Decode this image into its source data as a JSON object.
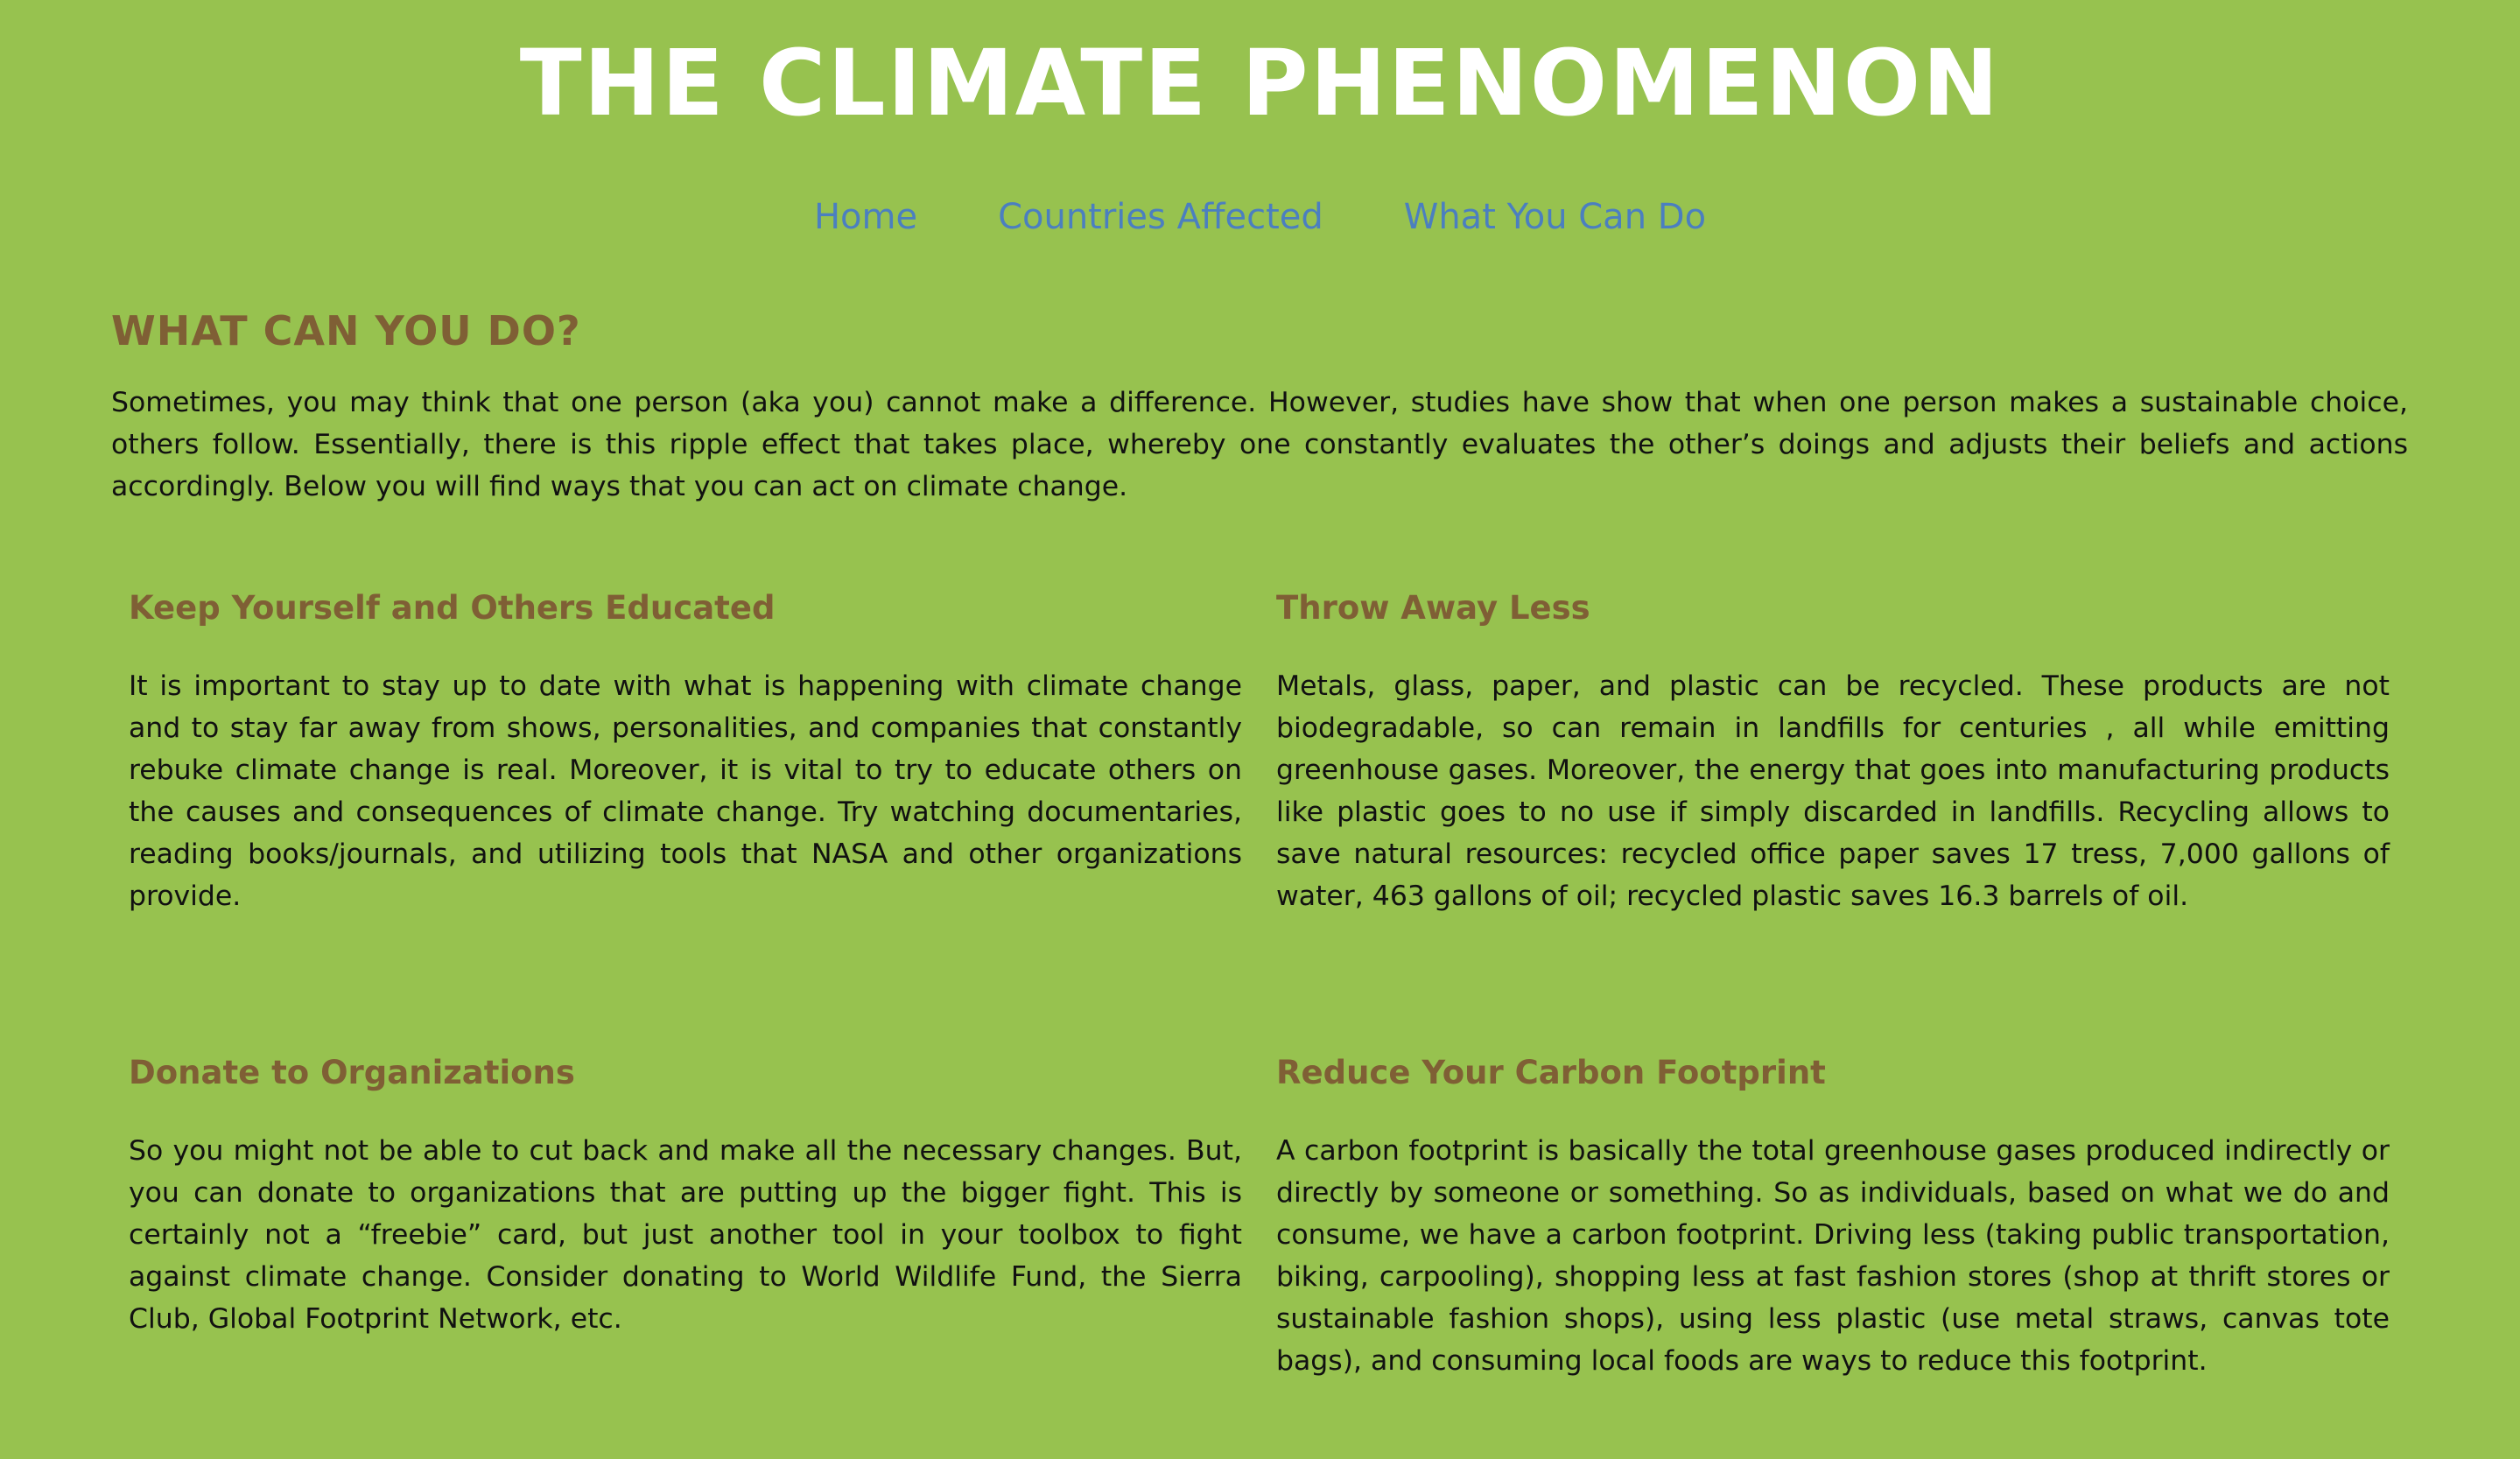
{
  "site": {
    "title": "THE CLIMATE PHENOMENON"
  },
  "nav": {
    "items": [
      {
        "label": "Home"
      },
      {
        "label": "Countries Affected"
      },
      {
        "label": "What You Can Do"
      }
    ]
  },
  "main": {
    "heading": "WHAT CAN YOU DO?",
    "intro": "Sometimes, you may think that one person (aka you) cannot make a difference. However, studies have show that when one person makes a sustainable choice, others follow. Essentially, there is this ripple effect that takes place, whereby one constantly evaluates the other’s doings and adjusts their beliefs and actions accordingly. Below you will find ways that you can act on climate change.",
    "sections": [
      {
        "title": "Keep Yourself and Others Educated",
        "body": "It is important to stay up to date with what is happening with climate change and to stay far away from shows, personalities, and companies that constantly rebuke climate change is real. Moreover, it is vital to try to educate others on the causes and consequences of climate change. Try watching documentaries, reading books/journals, and utilizing tools that NASA and other organizations provide."
      },
      {
        "title": "Throw Away Less",
        "body": "Metals, glass, paper, and plastic can be recycled. These products are not biodegradable, so can remain in landfills for centuries , all while emitting greenhouse gases. Moreover, the energy that goes into manufacturing products like plastic goes to no use if simply discarded in landfills. Recycling allows to save natural resources: recycled office paper saves 17 tress, 7,000 gallons of water, 463 gallons of oil; recycled plastic saves 16.3 barrels of oil."
      },
      {
        "title": "Donate to Organizations",
        "body": "So you might not be able to cut back and make all the necessary changes. But, you can donate to organizations that are putting up the bigger fight. This is certainly not a “freebie” card, but just another tool in your toolbox to fight against climate change. Consider donating to World Wildlife Fund, the Sierra Club, Global Footprint Network, etc."
      },
      {
        "title": "Reduce Your Carbon Footprint",
        "body": "A carbon footprint is basically the total greenhouse gases produced indirectly or directly by someone or something. So as individuals, based on what we do and consume, we have a carbon footprint. Driving less (taking public transportation, biking, carpooling), shopping less at fast fashion stores (shop at thrift stores or sustainable fashion shops), using less plastic (use metal straws, canvas tote bags), and consuming local foods are ways to reduce this footprint."
      }
    ]
  },
  "colors": {
    "background": "#97c24f",
    "title": "#ffffff",
    "nav_link": "#4b7fc0",
    "heading": "#7f5f35",
    "body_text": "#111111"
  }
}
